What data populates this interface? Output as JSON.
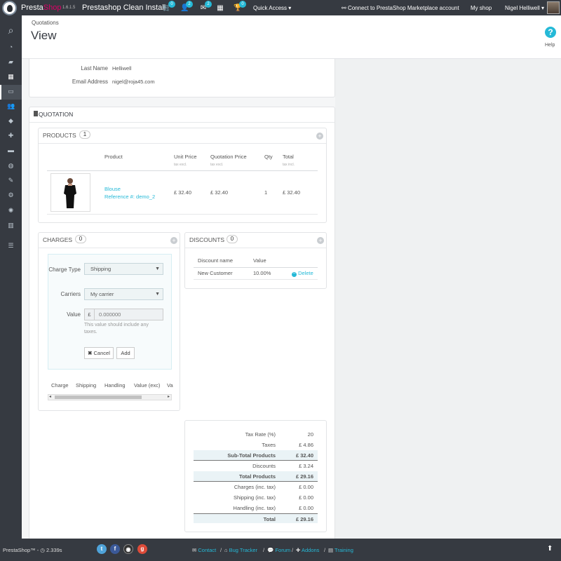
{
  "topbar": {
    "brand_presta": "Presta",
    "brand_shop": "Shop",
    "version": "1.6.1.5",
    "store_name": "Prestashop Clean Install",
    "badges": {
      "orders": "0",
      "customers": "2",
      "messages": "2",
      "notifications": "0"
    },
    "quick_access": "Quick Access",
    "connect": "Connect to PrestaShop Marketplace account",
    "my_shop": "My shop",
    "user": "Nigel Helliwell"
  },
  "header": {
    "breadcrumb": "Quotations",
    "title": "View",
    "help": "Help"
  },
  "customer": {
    "last_name_label": "Last Name",
    "last_name": "Helliwell",
    "email_label": "Email Address",
    "email": "nigel@roja45.com"
  },
  "quotation": {
    "title": "QUOTATION",
    "products": {
      "title": "PRODUCTS",
      "count": "1",
      "headers": {
        "product": "Product",
        "unit_price": "Unit Price",
        "unit_price_sub": "tax excl.",
        "quotation_price": "Quotation Price",
        "quotation_price_sub": "tax excl.",
        "qty": "Qty",
        "total": "Total",
        "total_sub": "tax incl."
      },
      "rows": [
        {
          "name": "Blouse",
          "reference": "Reference #: demo_2",
          "unit_price": "£ 32.40",
          "quotation_price": "£ 32.40",
          "qty": "1",
          "total": "£ 32.40"
        }
      ]
    },
    "charges": {
      "title": "CHARGES",
      "count": "0",
      "charge_type_label": "Charge Type",
      "charge_type_value": "Shipping",
      "carriers_label": "Carriers",
      "carriers_value": "My carrier",
      "value_label": "Value",
      "currency": "£",
      "value_placeholder": "0.000000",
      "value_help": "This value should include any taxes.",
      "cancel": "Cancel",
      "add": "Add",
      "columns": [
        "Charge",
        "Shipping",
        "Handling",
        "Value (exc)",
        "Va"
      ]
    },
    "discounts": {
      "title": "DISCOUNTS",
      "count": "0",
      "headers": {
        "name": "Discount name",
        "value": "Value"
      },
      "rows": [
        {
          "name": "New Customer",
          "value": "10.00%",
          "action": "Delete"
        }
      ]
    },
    "summary": {
      "rows": [
        {
          "label": "Tax Rate (%)",
          "value": "20"
        },
        {
          "label": "Taxes",
          "value": "£ 4.86"
        },
        {
          "label": "Sub-Total Products",
          "value": "£ 32.40"
        },
        {
          "label": "Discounts",
          "value": "£ 3.24"
        },
        {
          "label": "Total Products",
          "value": "£ 29.16"
        },
        {
          "label": "Charges (inc. tax)",
          "value": "£ 0.00"
        },
        {
          "label": "Shipping (inc. tax)",
          "value": "£ 0.00"
        },
        {
          "label": "Handling (inc. tax)",
          "value": "£ 0.00"
        },
        {
          "label": "Total",
          "value": "£ 29.16"
        }
      ]
    }
  },
  "footer": {
    "brand": "PrestaShop™",
    "load_time": "2.339s",
    "links": [
      "Contact",
      "Bug Tracker",
      "Forum",
      "Addons",
      "Training"
    ]
  },
  "colors": {
    "accent": "#25b9d7",
    "sidebar": "#363a41",
    "brand_pink": "#df0067"
  }
}
